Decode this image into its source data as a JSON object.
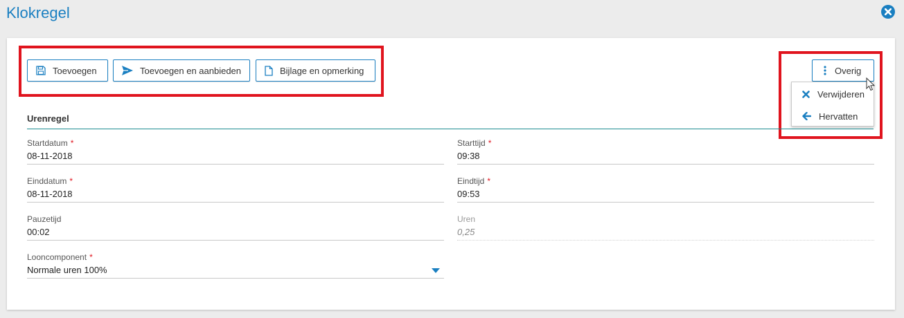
{
  "header": {
    "title": "Klokregel"
  },
  "toolbar": {
    "add_label": "Toevoegen",
    "add_offer_label": "Toevoegen en aanbieden",
    "attachment_label": "Bijlage en opmerking",
    "more_label": "Overig"
  },
  "more_menu": {
    "items": [
      {
        "label": "Verwijderen",
        "icon": "x-icon"
      },
      {
        "label": "Hervatten",
        "icon": "arrow-left-icon"
      }
    ]
  },
  "form": {
    "section_title": "Urenregel",
    "fields": {
      "startdatum": {
        "label": "Startdatum",
        "value": "08-11-2018",
        "required": true
      },
      "starttijd": {
        "label": "Starttijd",
        "value": "09:38",
        "required": true
      },
      "einddatum": {
        "label": "Einddatum",
        "value": "08-11-2018",
        "required": true
      },
      "eindtijd": {
        "label": "Eindtijd",
        "value": "09:53",
        "required": true
      },
      "pauzetijd": {
        "label": "Pauzetijd",
        "value": "00:02",
        "required": false
      },
      "uren": {
        "label": "Uren",
        "value": "0,25",
        "required": false,
        "readonly": true
      },
      "looncomponent": {
        "label": "Looncomponent",
        "value": "Normale uren 100%",
        "required": true
      }
    },
    "required_marker": "*"
  },
  "colors": {
    "accent": "#1a7fc1",
    "highlight": "#e0141e",
    "section_line": "#1a8a8f",
    "background": "#ececec"
  }
}
